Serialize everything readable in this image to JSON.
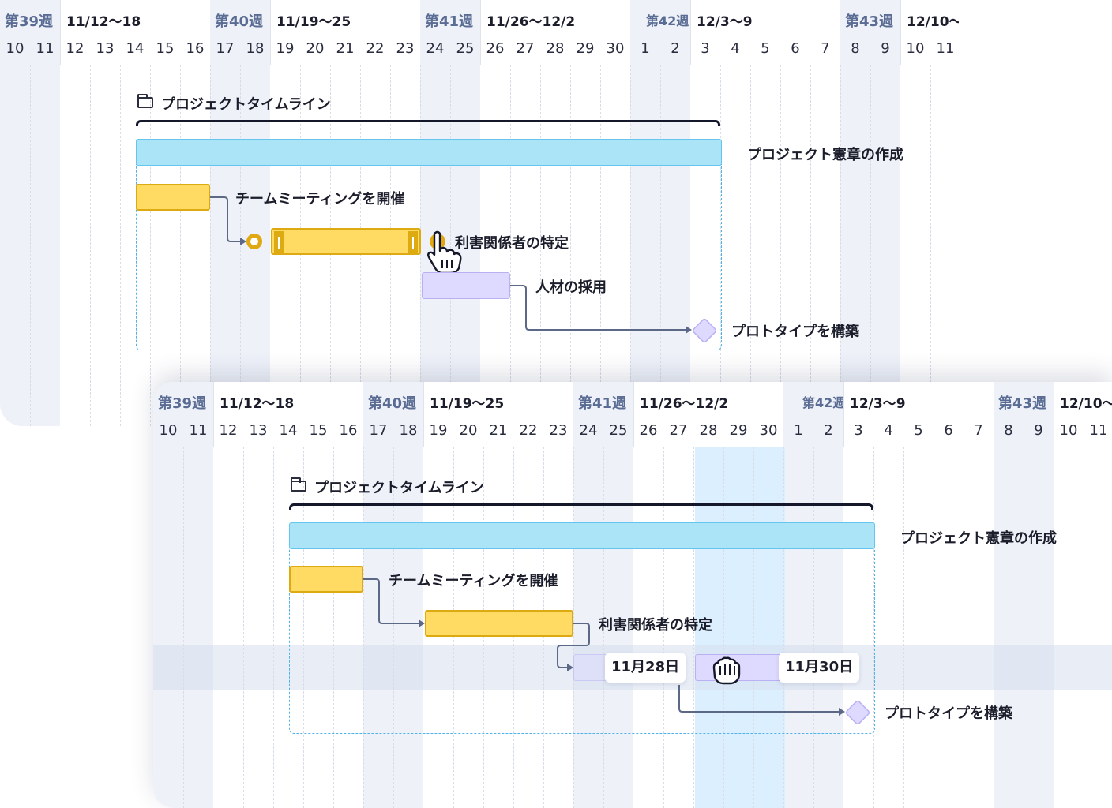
{
  "timeline": {
    "weeks": [
      {
        "label": "第39週",
        "range": "11/12〜18"
      },
      {
        "label": "第40週",
        "range": "11/19〜25"
      },
      {
        "label": "第41週",
        "range": "11/26〜12/2"
      },
      {
        "label": "第42週",
        "range": "12/3〜9"
      },
      {
        "label": "第43週",
        "range": "12/10〜"
      }
    ],
    "days": [
      "10",
      "11",
      "12",
      "13",
      "14",
      "15",
      "16",
      "17",
      "18",
      "19",
      "20",
      "21",
      "22",
      "23",
      "24",
      "25",
      "26",
      "27",
      "28",
      "29",
      "30",
      "1",
      "2",
      "3",
      "4",
      "5",
      "6",
      "7",
      "8",
      "9",
      "10",
      "11"
    ]
  },
  "project": {
    "title": "プロジェクトタイムライン",
    "charter": "プロジェクト憲章の作成",
    "tasks": {
      "meeting": "チームミーティングを開催",
      "stakeholders": "利害関係者の特定",
      "hiring": "人材の採用",
      "prototype": "プロトタイプを構築"
    }
  },
  "drag": {
    "start_date": "11月28日",
    "end_date": "11月30日"
  },
  "colors": {
    "week_shade": "#eef1f8",
    "summary_bar": "#abe3f7",
    "task_yellow": "#ffdb63",
    "task_purple": "#ddd9ff",
    "connector": "#5b6886",
    "highlight": "#dcefff"
  },
  "icons": [
    "folder-icon",
    "pointer-hand-icon",
    "grab-hand-icon"
  ]
}
